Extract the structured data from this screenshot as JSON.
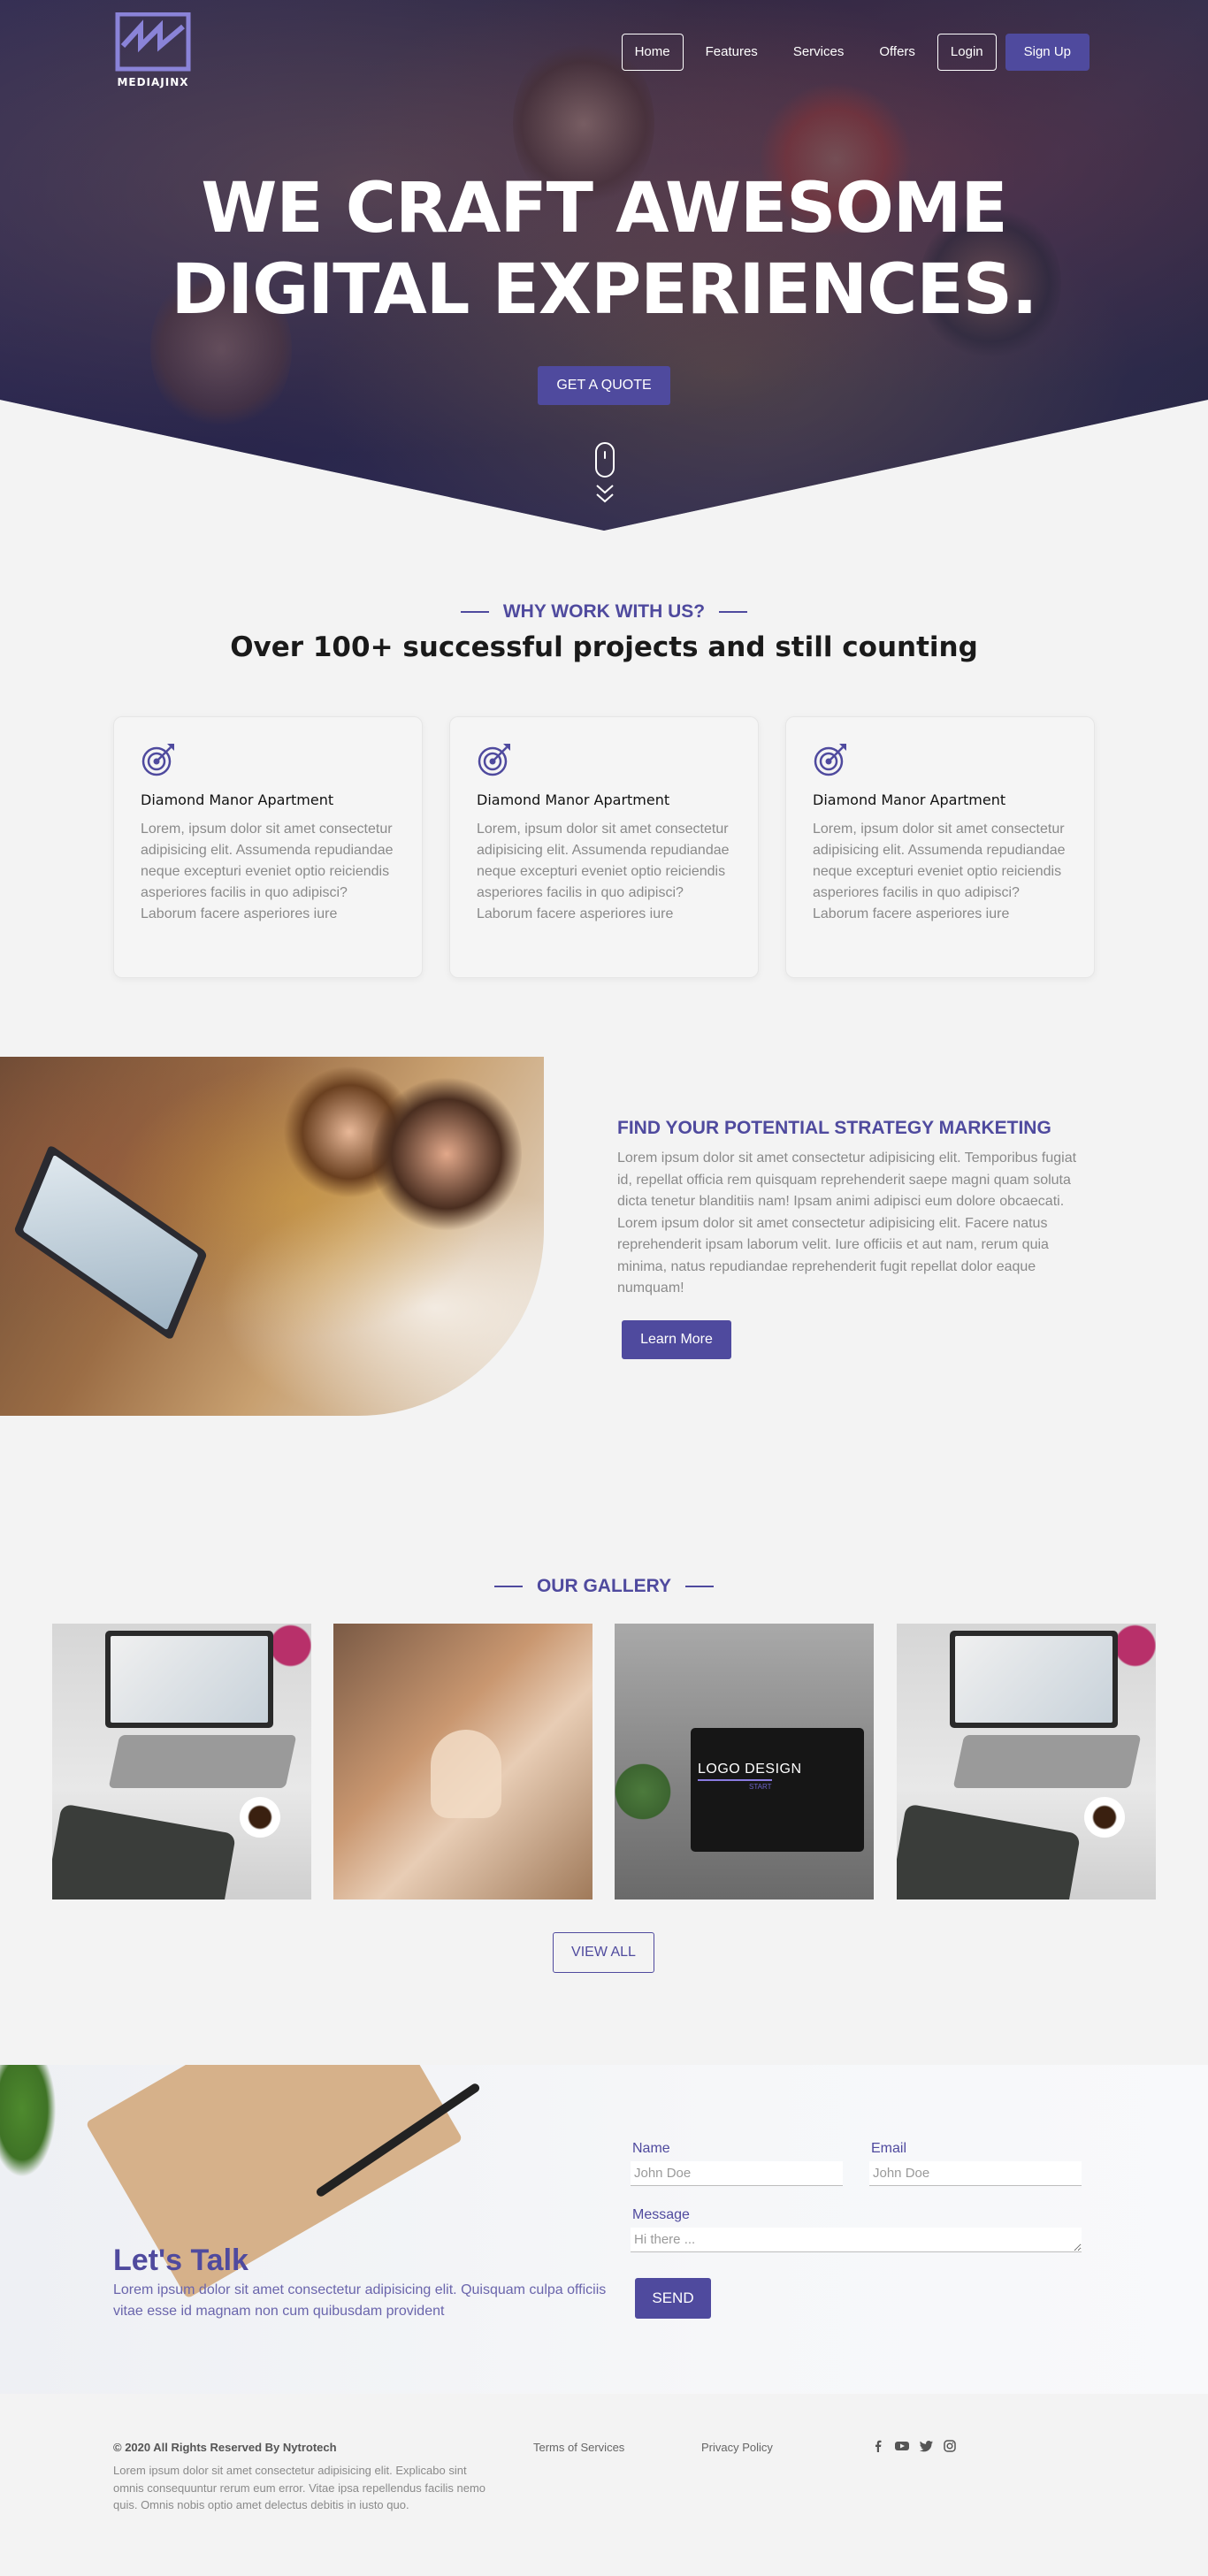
{
  "brand": {
    "name": "MEDIAJINX"
  },
  "nav": {
    "items": [
      {
        "label": "Home",
        "style": "boxed"
      },
      {
        "label": "Features",
        "style": "plain"
      },
      {
        "label": "Services",
        "style": "plain"
      },
      {
        "label": "Offers",
        "style": "plain"
      }
    ],
    "login_label": "Login",
    "signup_label": "Sign Up"
  },
  "hero": {
    "title_line1": "WE CRAFT AWESOME",
    "title_line2": "DIGITAL EXPERIENCES.",
    "cta_label": "GET A QUOTE"
  },
  "why": {
    "kicker": "WHY WORK WITH US?",
    "subtitle": "Over 100+ successful projects and still counting",
    "cards": [
      {
        "icon": "target-icon",
        "title": "Diamond Manor Apartment",
        "body": "Lorem, ipsum dolor sit amet consectetur adipisicing elit. Assumenda repudiandae neque excepturi eveniet optio reiciendis asperiores facilis in quo adipisci? Laborum facere asperiores iure"
      },
      {
        "icon": "target-icon",
        "title": "Diamond Manor Apartment",
        "body": "Lorem, ipsum dolor sit amet consectetur adipisicing elit. Assumenda repudiandae neque excepturi eveniet optio reiciendis asperiores facilis in quo adipisci? Laborum facere asperiores iure"
      },
      {
        "icon": "target-icon",
        "title": "Diamond Manor Apartment",
        "body": "Lorem, ipsum dolor sit amet consectetur adipisicing elit. Assumenda repudiandae neque excepturi eveniet optio reiciendis asperiores facilis in quo adipisci? Laborum facere asperiores iure"
      }
    ]
  },
  "strategy": {
    "title": "FIND YOUR POTENTIAL STRATEGY MARKETING",
    "body": "Lorem ipsum dolor sit amet consectetur adipisicing elit. Temporibus fugiat id, repellat officia rem quisquam reprehenderit saepe magni quam soluta dicta tenetur blanditiis nam! Ipsam animi adipisci eum dolore obcaecati. Lorem ipsum dolor sit amet consectetur adipisicing elit. Facere natus reprehenderit ipsam laborum velit. Iure officiis et aut nam, rerum quia minima, natus repudiandae reprehenderit fugit repellat dolor eaque numquam!",
    "button_label": "Learn More"
  },
  "gallery": {
    "kicker": "OUR GALLERY",
    "logo_design_text": "LOGO DESIGN",
    "logo_design_sub": "START",
    "view_all_label": "VIEW ALL"
  },
  "contact": {
    "title": "Let's Talk",
    "body": "Lorem ipsum dolor sit amet consectetur adipisicing elit. Quisquam culpa officiis vitae esse id magnam non cum quibusdam provident",
    "name_label": "Name",
    "name_placeholder": "John Doe",
    "email_label": "Email",
    "email_placeholder": "John Doe",
    "message_label": "Message",
    "message_placeholder": "Hi there ...",
    "send_label": "SEND"
  },
  "footer": {
    "copyright": "© 2020 All Rights Reserved By Nytrotech",
    "body": "Lorem ipsum dolor sit amet consectetur adipisicing elit. Explicabo sint omnis consequuntur rerum eum error. Vitae ipsa repellendus facilis nemo quis. Omnis nobis optio amet delectus debitis in iusto quo.",
    "terms_label": "Terms of Services",
    "privacy_label": "Privacy Policy",
    "social_icons": [
      "facebook-icon",
      "youtube-icon",
      "twitter-icon",
      "instagram-icon"
    ]
  },
  "colors": {
    "accent": "#4f4a9e",
    "background": "#f3f3f3"
  }
}
